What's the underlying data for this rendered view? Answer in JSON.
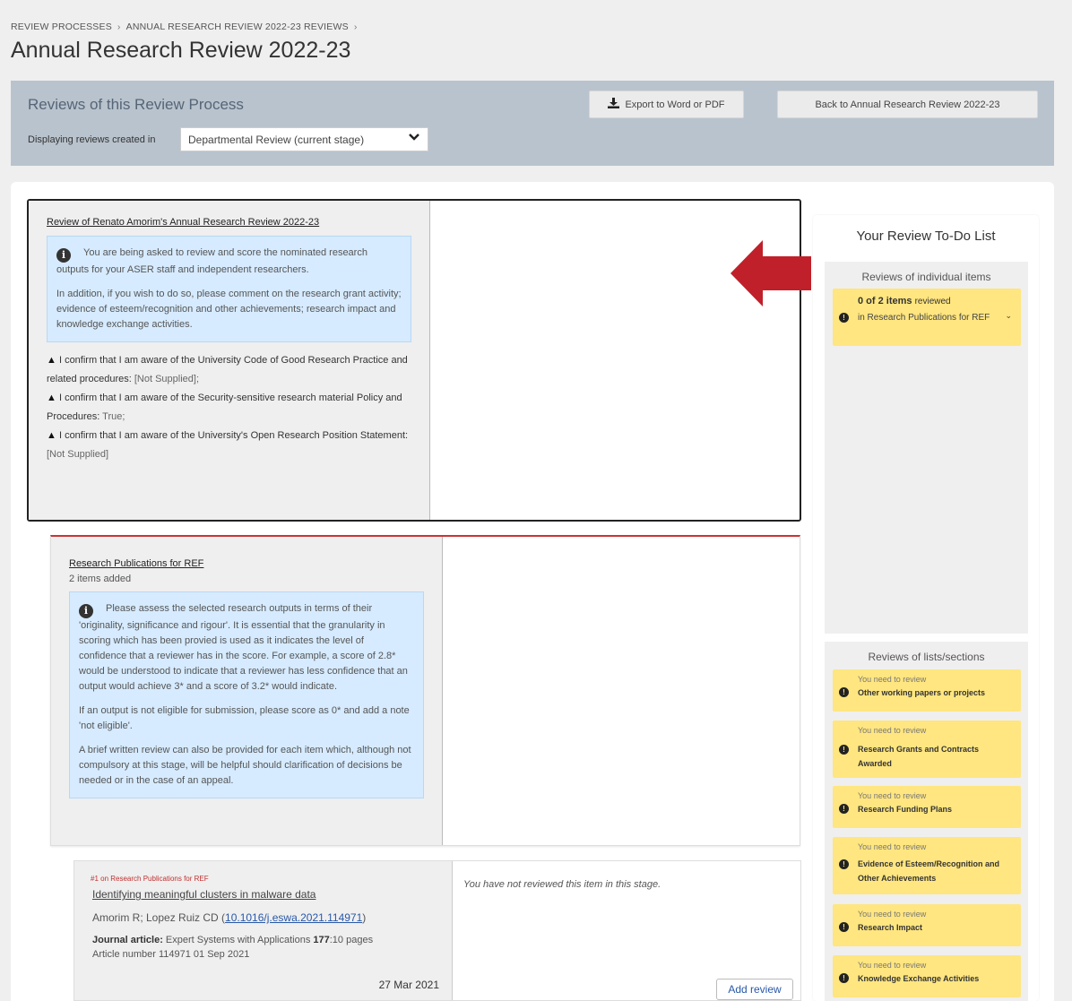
{
  "breadcrumb": {
    "item1": "REVIEW PROCESSES",
    "item2": "ANNUAL RESEARCH REVIEW 2022-23 REVIEWS",
    "sep": "›"
  },
  "page_title": "Annual Research Review 2022-23",
  "banner": {
    "title": "Reviews of this Review Process",
    "display_label": "Displaying reviews created in",
    "stage_value": "Departmental Review (current stage)",
    "export_label": "Export to Word or PDF",
    "back_label": "Back to Annual Research Review 2022-23"
  },
  "review": {
    "title": "Review of Renato Amorim's Annual Research Review 2022-23",
    "info_p1": "You are being asked to review and score the nominated research outputs for your ASER staff and independent researchers.",
    "info_p2": "In addition, if you wish to do so, please comment on the research grant activity; evidence of esteem/recognition and other achievements; research impact and knowledge exchange activities.",
    "confirm1_label": "I confirm that I am aware of the University Code of Good Research Practice and related procedures:",
    "confirm1_value": "[Not Supplied];",
    "confirm2_label": "I confirm that I am aware of the Security-sensitive research material Policy and Procedures:",
    "confirm2_value": "True;",
    "confirm3_label": "I confirm that I am aware of the University's Open Research Position Statement:",
    "confirm3_value": "[Not Supplied]"
  },
  "section": {
    "title": "Research Publications for REF",
    "count": "2 items added",
    "info_p1": "Please assess the selected research outputs in terms of their 'originality, significance and rigour'. It is essential that the granularity in scoring which has been provied is used as it indicates the level of confidence that a reviewer has in the score. For example, a score of 2.8* would be understood to indicate that a reviewer has less confidence that an output would achieve 3* and a score of 3.2* would indicate.",
    "info_p2": "If an output is not eligible for submission, please score as 0* and add a note 'not eligible'.",
    "info_p3": "A brief written review can also be provided for each item which, although not compulsory at this stage, will be helpful should clarification of decisions be needed or in the case of an appeal."
  },
  "item": {
    "tag": "#1 on Research Publications for REF",
    "title": "Identifying meaningful clusters in malware data",
    "authors": "Amorim R; Lopez Ruiz CD (",
    "doi": "10.1016/j.eswa.2021.114971",
    "authors_end": ")",
    "type_label": "Journal article:",
    "journal": "Expert Systems with Applications",
    "volume": "177",
    "pages": ":10 pages",
    "article": "Article number 114971 01 Sep 2021",
    "date": "27 Mar 2021",
    "note": "You have not reviewed this item in this stage.",
    "add_review_label": "Add review"
  },
  "todo": {
    "title": "Your Review To-Do List",
    "individual_title": "Reviews of individual items",
    "individual_count": "0 of 2 items",
    "individual_count_suffix": "reviewed",
    "individual_where": "in Research Publications for REF",
    "lists_title": "Reviews of lists/sections",
    "need_label": "You need to review",
    "lists": [
      "Other working papers or projects",
      "Research Grants and Contracts Awarded",
      "Research Funding Plans",
      "Evidence of Esteem/Recognition and Other Achievements",
      "Research Impact",
      "Knowledge Exchange Activities"
    ]
  },
  "colors": {
    "banner": "#b9c3cd",
    "info": "#d6ebff",
    "todo_item": "#ffe680",
    "accent_red": "#c0202a"
  },
  "icons": {
    "export": "download-icon",
    "select": "chevron-down-icon",
    "info": "info-icon",
    "warning": "warning-icon",
    "alert": "exclamation-icon",
    "arrow": "arrow-left-icon"
  }
}
